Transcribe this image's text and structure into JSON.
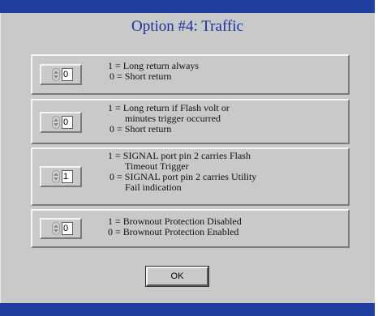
{
  "colors": {
    "title_bar": "#1f3f9f",
    "panel_background": "#c9c9c9",
    "heading_text": "#1f2fa0"
  },
  "dialog": {
    "heading": "Option #4: Traffic",
    "ok_label": "OK"
  },
  "options": [
    {
      "value": "0",
      "lines": [
        "1 = Long return always",
        "0 = Short return"
      ]
    },
    {
      "value": "0",
      "lines": [
        "1 = Long return if Flash volt or",
        "minutes trigger occurred",
        "0 = Short return"
      ]
    },
    {
      "value": "1",
      "lines": [
        "1 = SIGNAL port pin 2 carries Flash",
        "Timeout Trigger",
        "0 = SIGNAL port pin 2 carries Utility",
        "Fail indication"
      ]
    },
    {
      "value": "0",
      "lines": [
        "1 = Brownout Protection Disabled",
        "0 = Brownout Protection Enabled"
      ]
    }
  ],
  "icons": {
    "spinner": "up-down-spinner-icon"
  }
}
